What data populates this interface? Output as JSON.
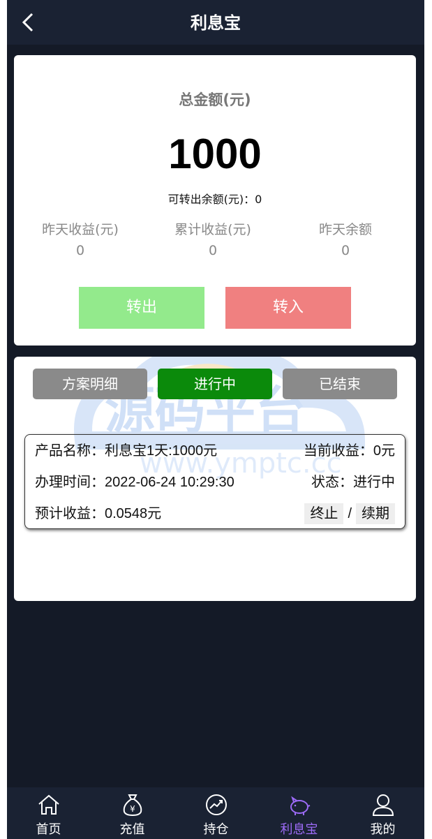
{
  "header": {
    "title": "利息宝"
  },
  "summary": {
    "total_label": "总金额(元)",
    "total_value": "1000",
    "transferable": "可转出余额(元)：0",
    "stats": [
      {
        "label": "昨天收益(元)",
        "value": "0"
      },
      {
        "label": "累计收益(元)",
        "value": "0"
      },
      {
        "label": "昨天余额",
        "value": "0"
      }
    ],
    "transfer_out": "转出",
    "transfer_in": "转入"
  },
  "tabs": {
    "plan": "方案明细",
    "ongoing": "进行中",
    "ended": "已结束",
    "selected": "进行中"
  },
  "order": {
    "product": "产品名称：利息宝1天:1000元",
    "current_income": "当前收益：0元",
    "time": "办理时间：2022-06-24 10:29:30",
    "status": "状态：进行中",
    "expected": "预计收益：0.0548元",
    "terminate": "终止",
    "separator": "/",
    "renew": "续期"
  },
  "watermark": {
    "title": "源码平台",
    "url": "www.ymptc.cc"
  },
  "tabbar": {
    "items": [
      {
        "label": "首页",
        "icon": "home-icon"
      },
      {
        "label": "充值",
        "icon": "money-bag-icon"
      },
      {
        "label": "持仓",
        "icon": "chart-icon"
      },
      {
        "label": "利息宝",
        "icon": "piggy-bank-icon"
      },
      {
        "label": "我的",
        "icon": "user-icon"
      }
    ],
    "active": "利息宝"
  },
  "colors": {
    "header_bg": "#1a2233",
    "page_bg": "#141a27",
    "active_tab": "#9d6bf7",
    "ongoing_tab": "#0b8a0b"
  }
}
